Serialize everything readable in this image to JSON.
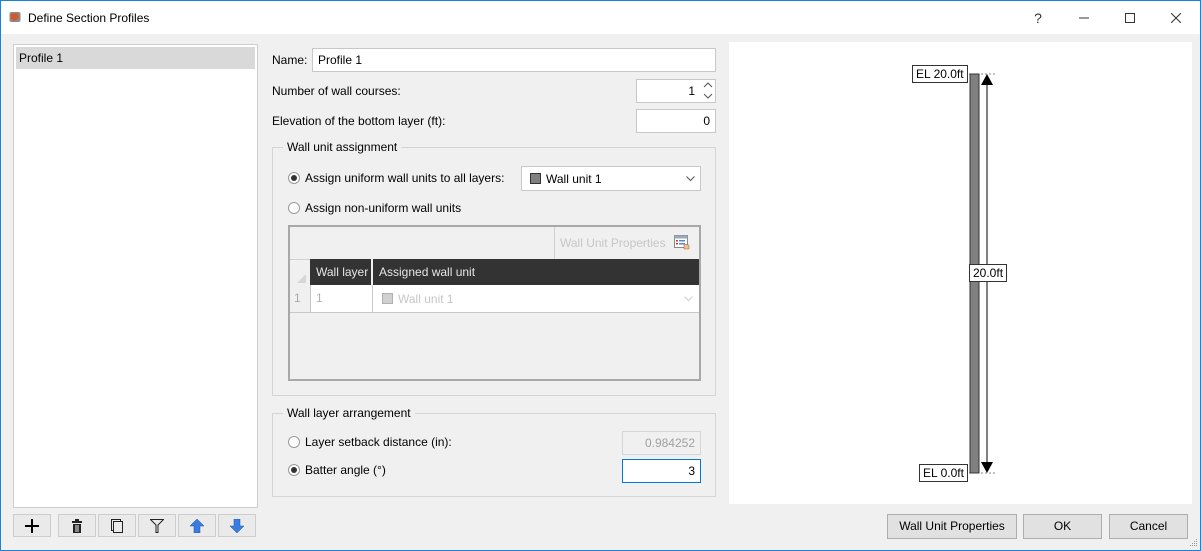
{
  "window": {
    "title": "Define Section Profiles",
    "buttons": {
      "help": "?",
      "minimize": "—",
      "maximize": "☐",
      "close": "✕"
    }
  },
  "sidebar": {
    "profiles": [
      {
        "label": "Profile 1",
        "selected": true
      }
    ],
    "toolbar": [
      {
        "name": "add-button",
        "icon": "plus-icon",
        "glyph": "+"
      },
      {
        "name": "delete-button",
        "icon": "trash-icon"
      },
      {
        "name": "copy-button",
        "icon": "copy-icon"
      },
      {
        "name": "filter-button",
        "icon": "filter-icon"
      },
      {
        "name": "move-up-button",
        "icon": "arrow-up-icon"
      },
      {
        "name": "move-down-button",
        "icon": "arrow-down-icon"
      }
    ]
  },
  "form": {
    "name_label": "Name:",
    "name_value": "Profile 1",
    "courses_label": "Number of wall courses:",
    "courses_value": "1",
    "elevation_label": "Elevation of the bottom layer (ft):",
    "elevation_value": "0"
  },
  "wall_unit_assignment": {
    "title": "Wall unit assignment",
    "uniform_label": "Assign uniform wall units to all layers:",
    "uniform_selected": true,
    "uniform_value": "Wall unit 1",
    "uniform_swatch_color": "#808080",
    "nonuniform_label": "Assign non-uniform wall units",
    "nonuniform_selected": false,
    "grid": {
      "toolbar_button": "Wall Unit Properties",
      "columns": [
        "Wall layer",
        "Assigned wall unit"
      ],
      "rows": [
        {
          "index": "1",
          "layer": "1",
          "unit": "Wall unit 1"
        }
      ]
    }
  },
  "wall_layer_arrangement": {
    "title": "Wall layer arrangement",
    "setback_label": "Layer setback distance (in):",
    "setback_selected": false,
    "setback_value": "0.984252",
    "batter_label": "Batter angle (°)",
    "batter_selected": true,
    "batter_value": "3"
  },
  "preview": {
    "top_label": "EL 20.0ft",
    "bottom_label": "EL 0.0ft",
    "height_label": "20.0ft",
    "wall_color": "#808080"
  },
  "footer": {
    "wall_unit_properties": "Wall Unit Properties",
    "ok": "OK",
    "cancel": "Cancel"
  },
  "colors": {
    "accent": "#1883d7",
    "header_dark": "#333333"
  }
}
